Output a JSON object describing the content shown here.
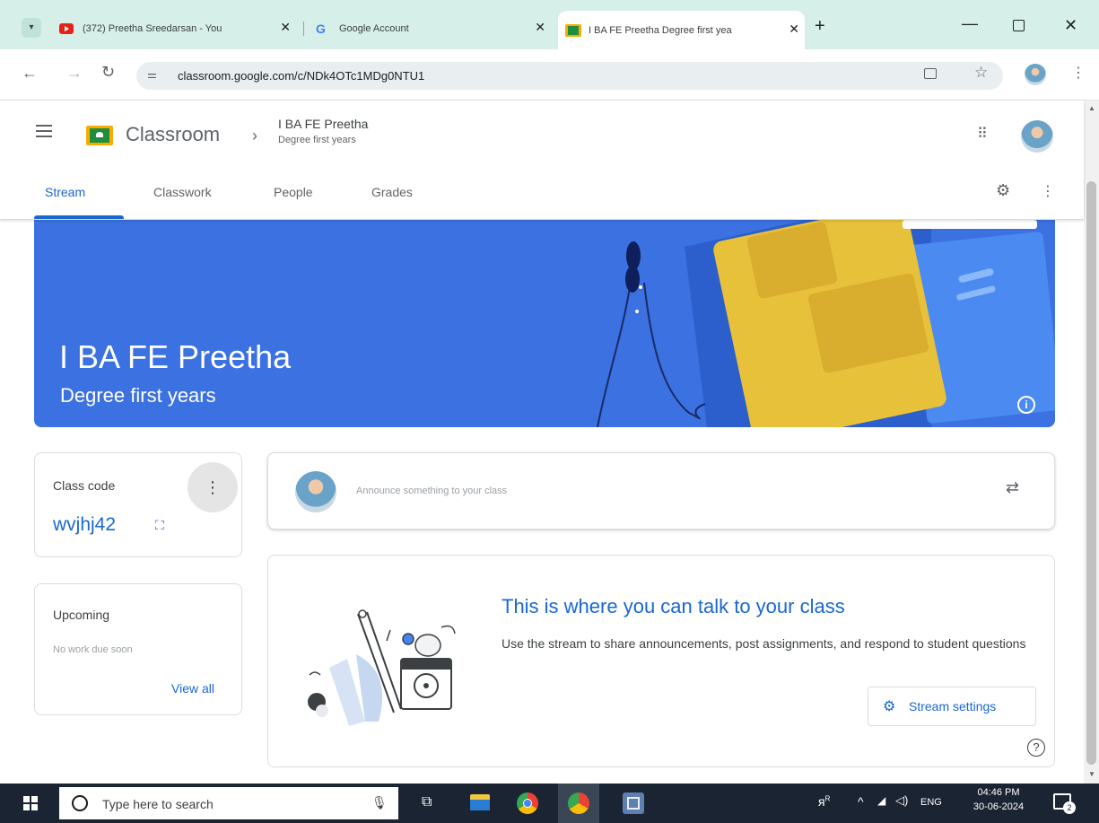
{
  "browser": {
    "tabs": [
      {
        "title": "(372) Preetha Sreedarsan - You",
        "icon": "youtube-icon",
        "active": false
      },
      {
        "title": "Google Account",
        "icon": "google-icon",
        "active": false
      },
      {
        "title": "I BA FE Preetha Degree first yea",
        "icon": "classroom-icon",
        "active": true
      }
    ],
    "url": "classroom.google.com/c/NDk4OTc1MDg0NTU1"
  },
  "app": {
    "name": "Classroom",
    "breadcrumb_title": "I BA FE Preetha",
    "breadcrumb_subtitle": "Degree first years",
    "nav_tabs": [
      "Stream",
      "Classwork",
      "People",
      "Grades"
    ],
    "active_tab": "Stream"
  },
  "banner": {
    "title": "I BA FE Preetha",
    "subtitle": "Degree first years",
    "color": "#3b71e0"
  },
  "class_code": {
    "label": "Class code",
    "code": "wvjhj42"
  },
  "upcoming": {
    "label": "Upcoming",
    "status": "No work due soon",
    "link": "View all"
  },
  "announce": {
    "placeholder": "Announce something to your class"
  },
  "stream_info": {
    "heading": "This is where you can talk to your class",
    "body": "Use the stream to share announcements, post assignments, and respond to student questions",
    "button": "Stream settings"
  },
  "taskbar": {
    "search_placeholder": "Type here to search",
    "language": "ENG",
    "time": "04:46 PM",
    "date": "30-06-2024",
    "notification_count": "2"
  }
}
